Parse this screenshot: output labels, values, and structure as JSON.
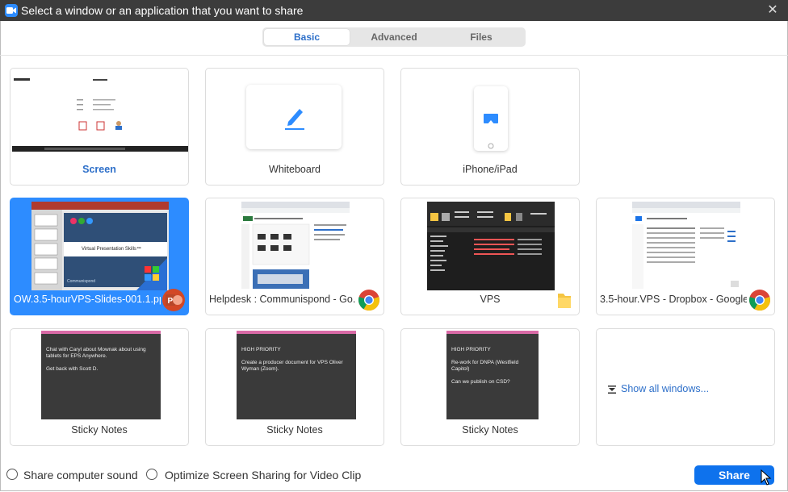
{
  "window": {
    "title": "Select a window or an application that you want to share",
    "close_glyph": "✕"
  },
  "tabs": [
    {
      "label": "Basic",
      "active": true
    },
    {
      "label": "Advanced",
      "active": false
    },
    {
      "label": "Files",
      "active": false
    }
  ],
  "cards": {
    "screen": {
      "label": "Screen"
    },
    "whiteboard": {
      "label": "Whiteboard"
    },
    "iphone": {
      "label": "iPhone/iPad"
    },
    "ppt": {
      "label": "OW.3.5-hourVPS-Slides-001.1.ppt...",
      "slide_title": "Virtual Presentation Skills™",
      "slide_brand": "Communispond"
    },
    "helpdesk": {
      "label": "Helpdesk : Communispond - Go..."
    },
    "vps": {
      "label": "VPS"
    },
    "dropbox": {
      "label": "3.5-hour.VPS - Dropbox - Google..."
    },
    "sticky1": {
      "label": "Sticky Notes",
      "line1": "Chat with Caryl about Mownak about using tablets for EPS Anywhere.",
      "line2": "Get back with Scott D."
    },
    "sticky2": {
      "label": "Sticky Notes",
      "line1": "HIGH PRIORITY",
      "line2": "Create a producer document for VPS Oliver Wyman (Zoom)."
    },
    "sticky3": {
      "label": "Sticky Notes",
      "line1": "HIGH PRIORITY",
      "line2": "Re-work for DNPA (Westfield Capitol)",
      "line3": "Can we publish on CSD?"
    },
    "show_all": {
      "label": "Show all windows..."
    }
  },
  "footer": {
    "share_sound": "Share computer sound",
    "optimize": "Optimize Screen Sharing for Video Clip",
    "share_button": "Share"
  },
  "colors": {
    "accent": "#0e72ed",
    "selected": "#2d8cff",
    "titlebar": "#3c3c3c",
    "sticky_top": "#d96aa6"
  }
}
